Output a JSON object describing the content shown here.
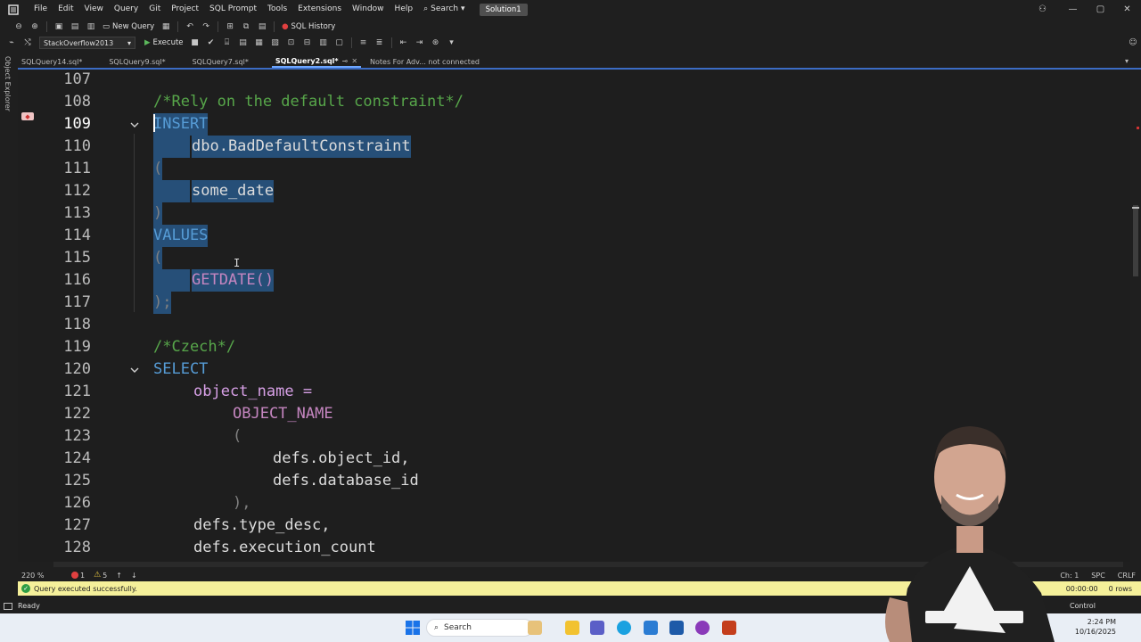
{
  "menubar": {
    "items": [
      "File",
      "Edit",
      "View",
      "Query",
      "Git",
      "Project",
      "SQL Prompt",
      "Tools",
      "Extensions",
      "Window",
      "Help"
    ],
    "search": "Search",
    "solution": "Solution1"
  },
  "toolbar": {
    "new_query": "New Query",
    "sql_history": "SQL History",
    "database": "StackOverflow2013",
    "execute": "Execute"
  },
  "left_strip": {
    "label": "Object Explorer"
  },
  "tabs": [
    {
      "label": "SQLQuery14.sql*",
      "active": false
    },
    {
      "label": "SQLQuery9.sql*",
      "active": false
    },
    {
      "label": "SQLQuery7.sql*",
      "active": false
    },
    {
      "label": "SQLQuery2.sql*",
      "active": true
    },
    {
      "label": "Notes For Adv... not connected",
      "active": false
    }
  ],
  "editor": {
    "lines": [
      {
        "n": "107",
        "text": ""
      },
      {
        "n": "108",
        "text": "/*Rely on the default constraint*/"
      },
      {
        "n": "109",
        "text": "INSERT"
      },
      {
        "n": "110",
        "text": "dbo.BadDefaultConstraint"
      },
      {
        "n": "111",
        "text": "("
      },
      {
        "n": "112",
        "text": "some_date"
      },
      {
        "n": "113",
        "text": ")"
      },
      {
        "n": "114",
        "text": "VALUES"
      },
      {
        "n": "115",
        "text": "("
      },
      {
        "n": "116",
        "text": "GETDATE()"
      },
      {
        "n": "117",
        "text": ");"
      },
      {
        "n": "118",
        "text": ""
      },
      {
        "n": "119",
        "text": "/*Czech*/"
      },
      {
        "n": "120",
        "text": "SELECT"
      },
      {
        "n": "121",
        "text": "object_name ="
      },
      {
        "n": "122",
        "text": "OBJECT_NAME"
      },
      {
        "n": "123",
        "text": "("
      },
      {
        "n": "124",
        "text": "defs.object_id,"
      },
      {
        "n": "125",
        "text": "defs.database_id"
      },
      {
        "n": "126",
        "text": "),"
      },
      {
        "n": "127",
        "text": "defs.type_desc,"
      },
      {
        "n": "128",
        "text": "defs.execution_count"
      }
    ],
    "current_line": "109"
  },
  "footer": {
    "zoom": "220 %",
    "errors": "1",
    "warnings": "5",
    "ch": "Ch: 1",
    "spc": "SPC",
    "crlf": "CRLF"
  },
  "query_status": {
    "message": "Query executed successfully.",
    "elapsed": "00:00:00",
    "rows": "0 rows"
  },
  "statusbar": {
    "ready": "Ready",
    "source_control": "Control"
  },
  "taskbar": {
    "search": "Search",
    "time": "2:24 PM",
    "date": "10/16/2025"
  },
  "colors": {
    "accent": "#3b6cc4",
    "selection": "#264f78",
    "comment": "#57a64a",
    "keyword": "#569cd6",
    "function": "#c586c0",
    "status_yellow": "#f5f09a"
  }
}
